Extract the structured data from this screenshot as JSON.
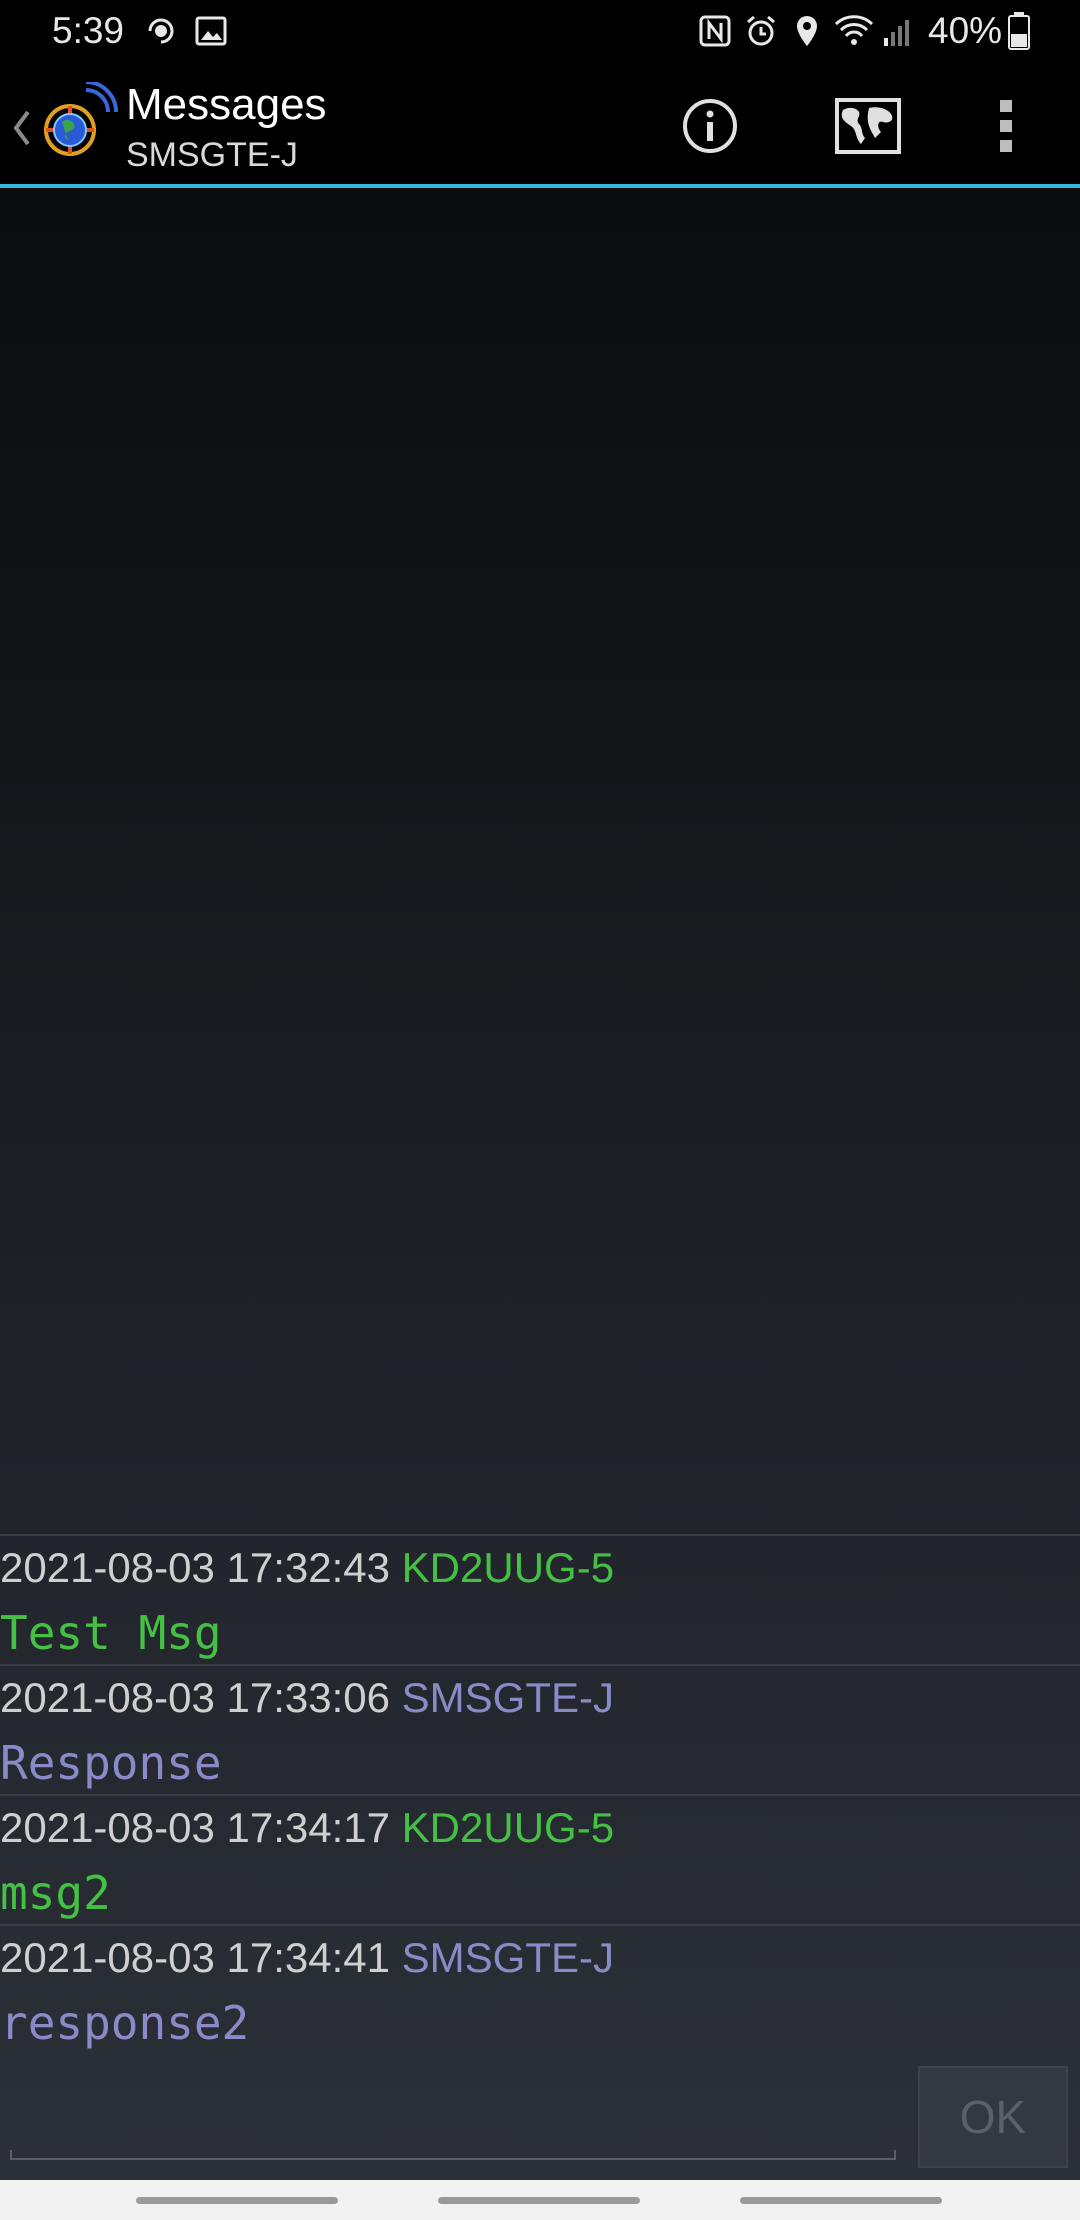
{
  "status_bar": {
    "time": "5:39",
    "battery": "40%",
    "icons": [
      "location-sharing-icon",
      "image-icon",
      "nfc-icon",
      "alarm-icon",
      "location-pin-icon",
      "wifi-icon",
      "signal-icon",
      "battery-icon"
    ]
  },
  "app_bar": {
    "title": "Messages",
    "subtitle": "SMSGTE-J",
    "actions": [
      "info-icon",
      "map-icon",
      "overflow-menu-icon"
    ]
  },
  "colors": {
    "accent": "#33b5e5",
    "callsign_self": "#44c044",
    "callsign_other": "#8a8ac8"
  },
  "messages": [
    {
      "time": "2021-08-03 17:32:43",
      "callsign": "KD2UUG-5",
      "body": "Test Msg",
      "color": "#44c044"
    },
    {
      "time": "2021-08-03 17:33:06",
      "callsign": "SMSGTE-J",
      "body": "Response",
      "color": "#8a8ac8"
    },
    {
      "time": "2021-08-03 17:34:17",
      "callsign": "KD2UUG-5",
      "body": "msg2",
      "color": "#44c044"
    },
    {
      "time": "2021-08-03 17:34:41",
      "callsign": "SMSGTE-J",
      "body": "response2",
      "color": "#8a8ac8"
    }
  ],
  "composer": {
    "input_value": "",
    "ok_label": "OK"
  }
}
